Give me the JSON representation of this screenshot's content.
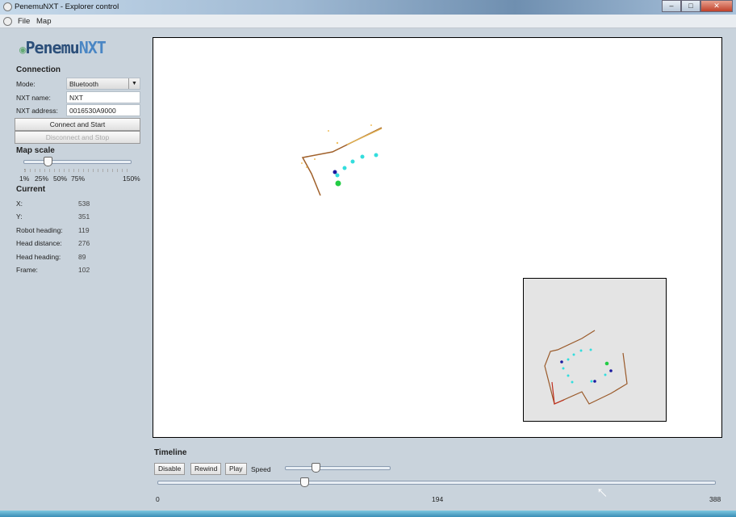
{
  "window": {
    "title": "PenemuNXT - Explorer control",
    "minimize": "–",
    "maximize": "□",
    "close": "✕"
  },
  "menu": [
    "File",
    "Map"
  ],
  "logo": {
    "part1": "Penemu",
    "part2": "NXT"
  },
  "connection": {
    "heading": "Connection",
    "mode_label": "Mode:",
    "mode_value": "Bluetooth",
    "name_label": "NXT name:",
    "name_value": "NXT",
    "address_label": "NXT address:",
    "address_value": "0016530A9000",
    "connect_button": "Connect and Start",
    "disconnect_button": "Disconnect and Stop"
  },
  "map_scale": {
    "heading": "Map scale",
    "ticks": [
      "1%",
      "25%",
      "50%",
      "75%",
      "150%"
    ],
    "value_percent": 25
  },
  "current": {
    "heading": "Current",
    "rows": [
      {
        "label": "X:",
        "value": "538"
      },
      {
        "label": "Y:",
        "value": "351"
      },
      {
        "label": "Robot heading:",
        "value": "119"
      },
      {
        "label": "Head distance:",
        "value": "276"
      },
      {
        "label": "Head heading:",
        "value": "89"
      },
      {
        "label": "Frame:",
        "value": "102"
      }
    ]
  },
  "timeline": {
    "heading": "Timeline",
    "disable": "Disable",
    "rewind": "Rewind",
    "play": "Play",
    "speed_label": "Speed",
    "speed_fraction": 0.29,
    "frame": 102,
    "min_label": "0",
    "mid_label": "194",
    "max_label": "388"
  },
  "colors": {
    "wall": "#b5651d",
    "sensor": "#f0c060",
    "robot_path": "#33dddd",
    "robot": "#1a1aa0",
    "current": "#22cc44"
  }
}
